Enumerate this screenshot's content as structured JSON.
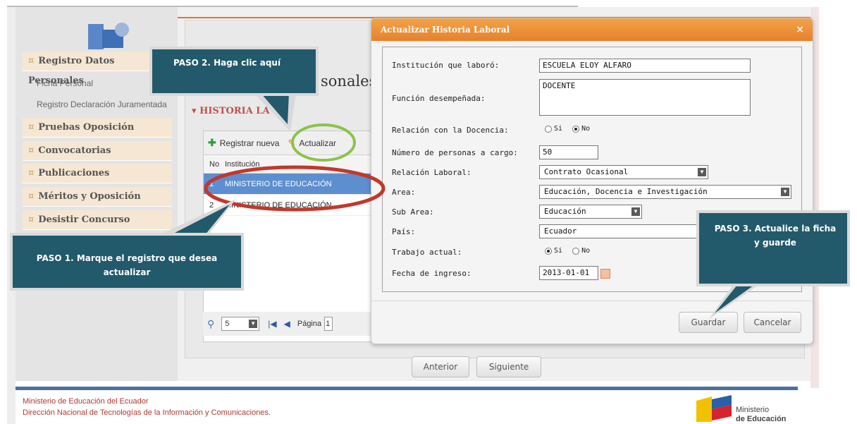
{
  "sidebar": {
    "menu": [
      {
        "label": "Registro Datos Personales"
      },
      {
        "label": "Pruebas Oposición"
      },
      {
        "label": "Convocatorias"
      },
      {
        "label": "Publicaciones"
      },
      {
        "label": "Méritos y Oposición"
      },
      {
        "label": "Desistir Concurso"
      }
    ],
    "submenu": [
      {
        "label": "Ficha Personal"
      },
      {
        "label": "Registro Declaración Juramentada"
      }
    ]
  },
  "main": {
    "page_heading": "sonales",
    "section_title": "HISTORIA LA",
    "toolbar": {
      "register": "Registrar nueva",
      "update": "Actualizar"
    },
    "grid_header": {
      "no": "No",
      "institution": "Institución"
    },
    "rows": [
      {
        "no": "1",
        "institution": "MINISTERIO DE EDUCACIÓN"
      },
      {
        "no": "2",
        "institution": "MINISTERIO DE EDUCACIÓN"
      }
    ],
    "pager": {
      "page_size": "5",
      "page_label": "Página",
      "page_value": "1"
    },
    "nav": {
      "previous": "Anterior",
      "next": "Siguiente"
    }
  },
  "dialog": {
    "title": "Actualizar Historia Laboral",
    "close": "×",
    "fields": {
      "institucion_label": "Institución que laboró:",
      "institucion_value": "ESCUELA ELOY ALFARO",
      "funcion_label": "Función desempeñada:",
      "funcion_value": "DOCENTE",
      "relacion_docencia_label": "Relación con la Docencia:",
      "personas_label": "Número de personas a cargo:",
      "personas_value": "50",
      "relacion_laboral_label": "Relación Laboral:",
      "relacion_laboral_value": "Contrato Ocasional",
      "area_label": "Area:",
      "area_value": "Educación, Docencia e Investigación",
      "subarea_label": "Sub Area:",
      "subarea_value": "Educación",
      "pais_label": "País:",
      "pais_value": "Ecuador",
      "trabajo_actual_label": "Trabajo actual:",
      "fecha_label": "Fecha de ingreso:",
      "fecha_value": "2013-01-01"
    },
    "radio": {
      "si": "Si",
      "no": "No",
      "docencia_selected": "No",
      "trabajo_selected": "Si"
    },
    "buttons": {
      "save": "Guardar",
      "cancel": "Cancelar"
    }
  },
  "callouts": {
    "paso1": "PASO 1. Marque el registro que desea actualizar",
    "paso2": "PASO 2. Haga clic aquí",
    "paso3": "PASO 3. Actualice la ficha y guarde"
  },
  "footer": {
    "line1": "Ministerio de Educación del Ecuador",
    "line2": "Dirección Nacional de Tecnologías de la Información y Comunicaciones.",
    "logo_line1": "Ministerio",
    "logo_line2": "de Educación"
  },
  "colors": {
    "dialog_title": "#e6812c",
    "callout": "#22596b",
    "selected_row": "#5d8fcf",
    "annotation_red": "#c0392b",
    "annotation_green": "#8bc34a"
  }
}
